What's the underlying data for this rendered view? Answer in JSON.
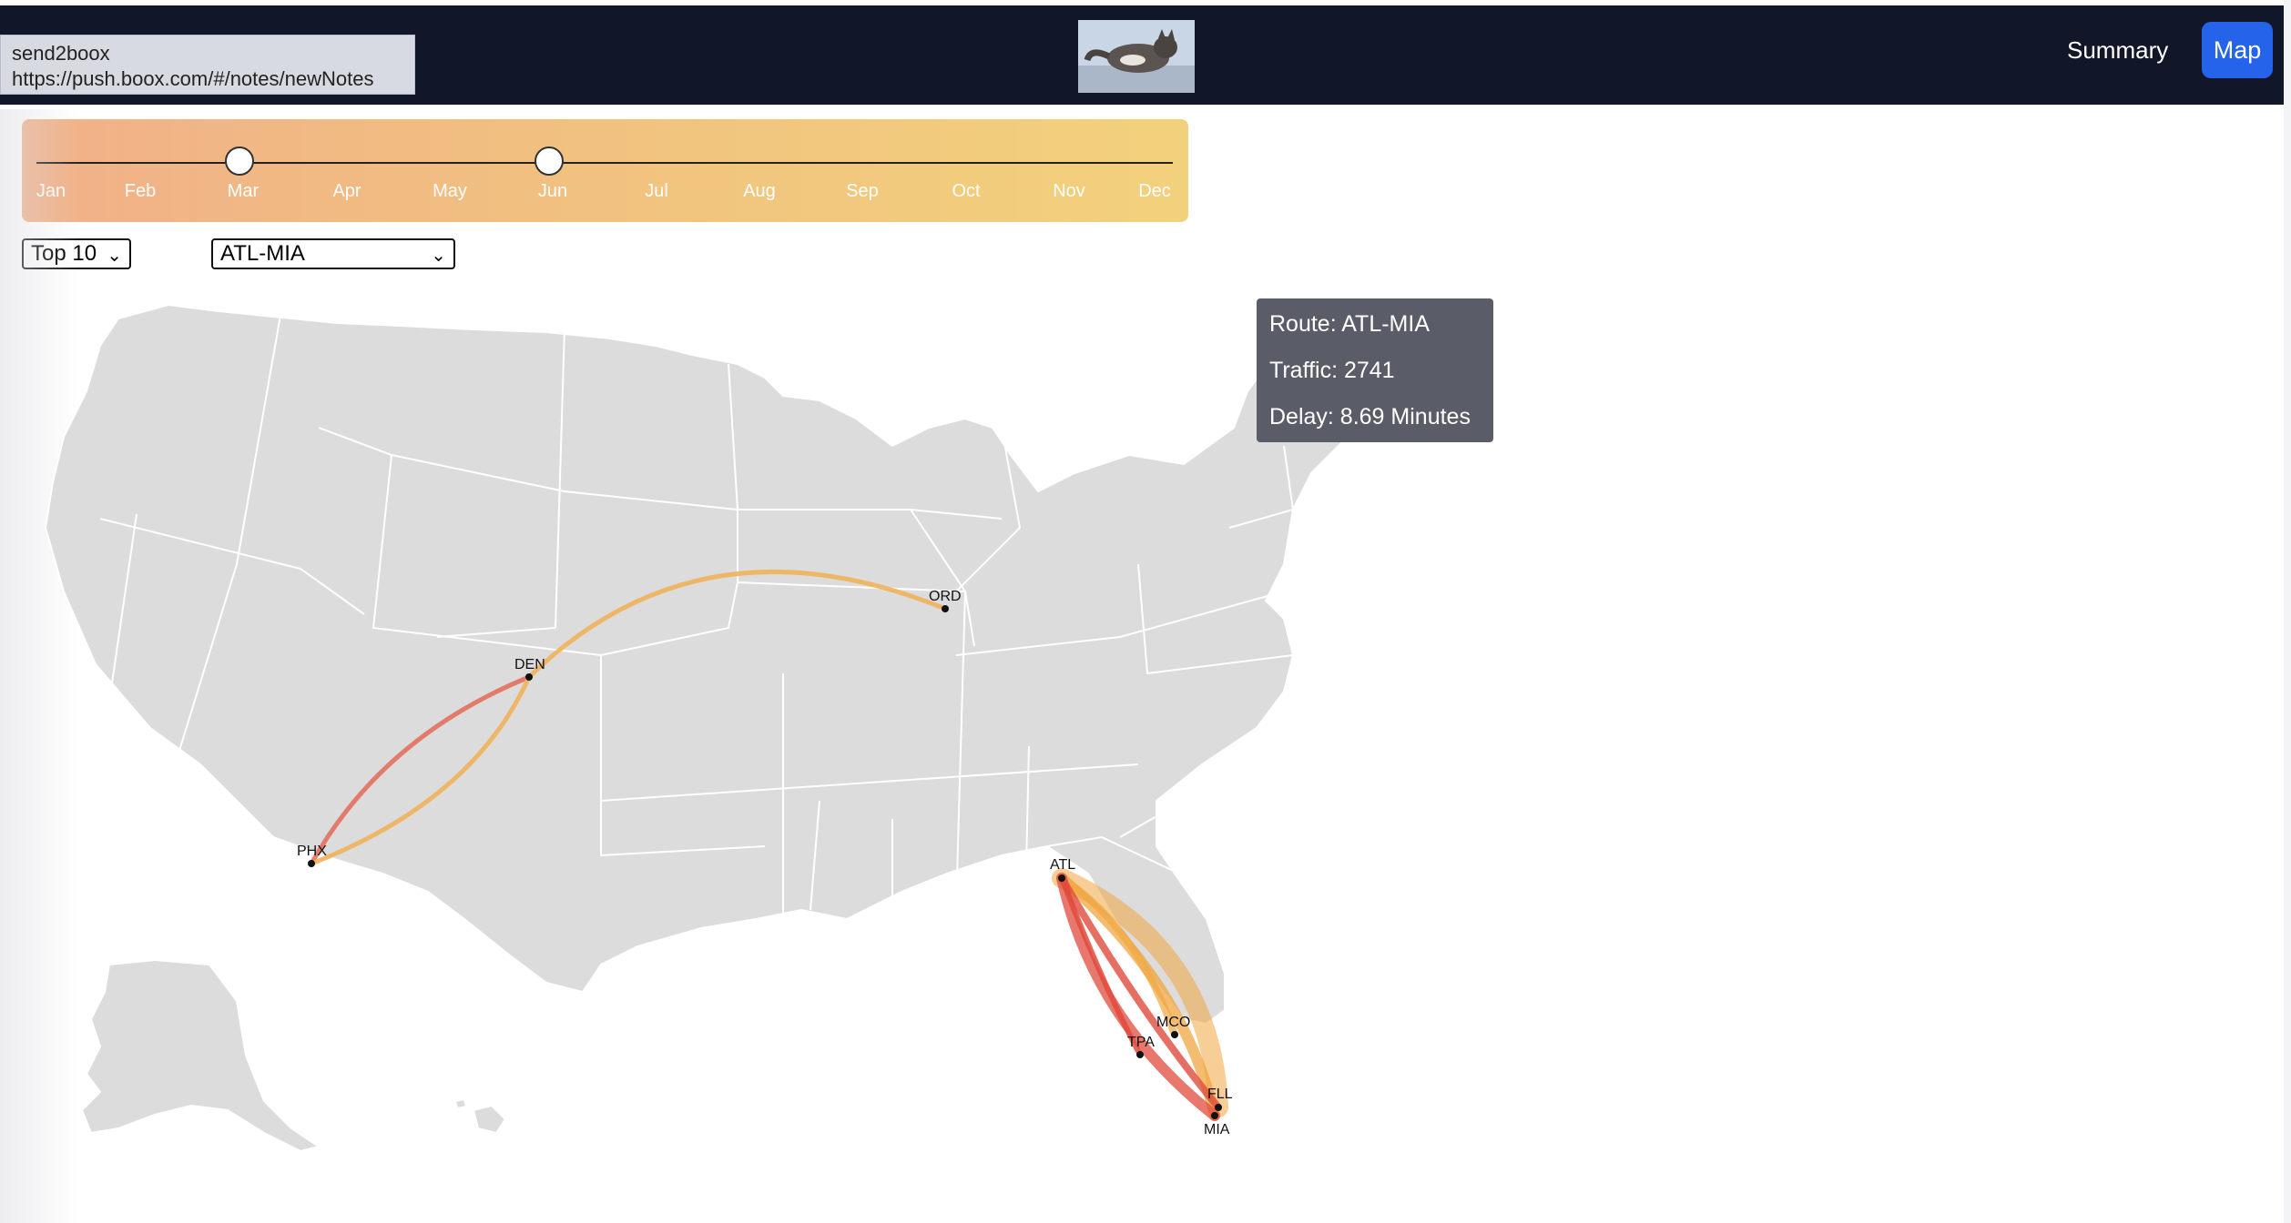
{
  "url_tooltip": {
    "title": "send2boox",
    "url": "https://push.boox.com/#/notes/newNotes"
  },
  "nav": {
    "summary_label": "Summary",
    "map_label": "Map"
  },
  "month_slider": {
    "months": [
      "Jan",
      "Feb",
      "Mar",
      "Apr",
      "May",
      "Jun",
      "Jul",
      "Aug",
      "Sep",
      "Oct",
      "Nov",
      "Dec"
    ],
    "range_start": "Mar",
    "range_end": "Jun"
  },
  "filters": {
    "top_n": "Top 10",
    "route": "ATL-MIA"
  },
  "tooltip": {
    "route": "Route: ATL-MIA",
    "traffic": "Traffic: 2741",
    "delay": "Delay: 8.69 Minutes"
  },
  "airports": {
    "ORD": "ORD",
    "DEN": "DEN",
    "PHX": "PHX",
    "ATL": "ATL",
    "MCO": "MCO",
    "TPA": "TPA",
    "FLL": "FLL",
    "MIA": "MIA"
  },
  "colors": {
    "nav_bg": "#111729",
    "map_button": "#2563eb",
    "land": "#dcdcdc",
    "route_orange": "#efb35a",
    "route_red": "#e04b3c",
    "tooltip_bg": "#5a5d68"
  }
}
